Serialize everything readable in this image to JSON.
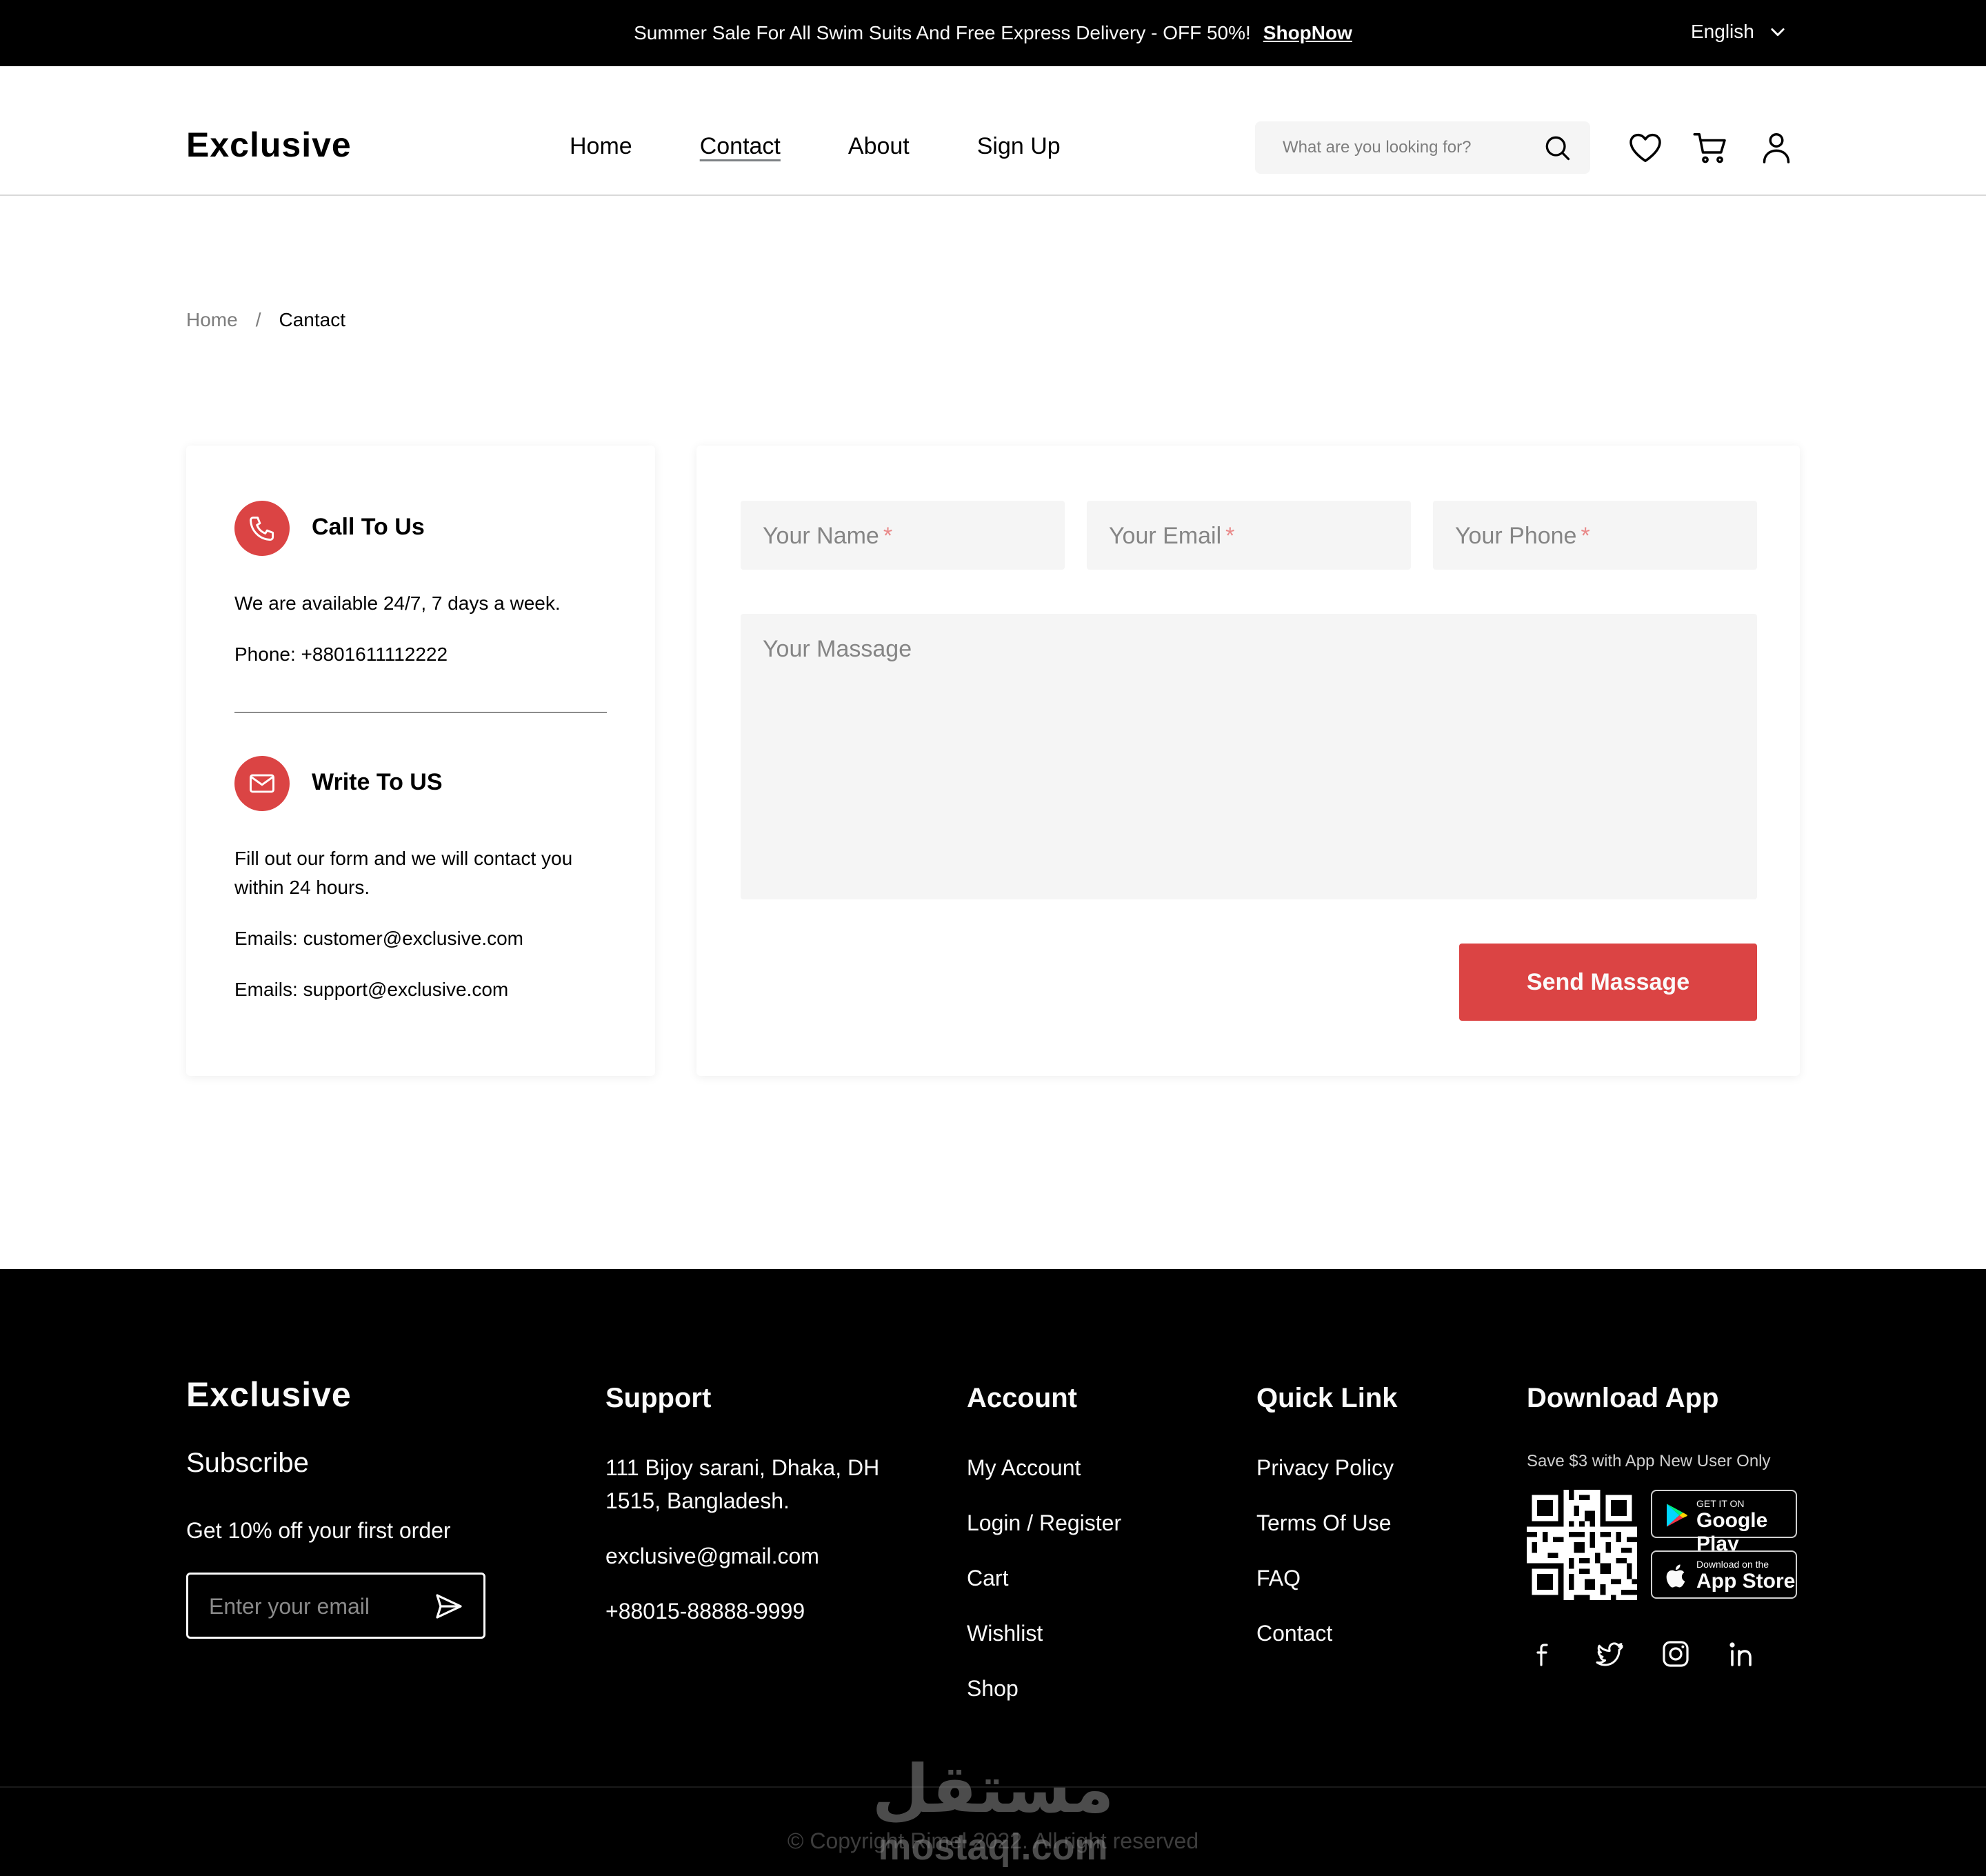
{
  "topbar": {
    "promo_text": "Summer Sale For All Swim Suits And Free Express Delivery - OFF 50%!",
    "promo_link": "ShopNow",
    "language": "English"
  },
  "header": {
    "logo": "Exclusive",
    "nav": [
      {
        "label": "Home",
        "active": false
      },
      {
        "label": "Contact",
        "active": true
      },
      {
        "label": "About",
        "active": false
      },
      {
        "label": "Sign Up",
        "active": false
      }
    ],
    "search_placeholder": "What are you looking for?",
    "icons": [
      "heart-icon",
      "cart-icon",
      "user-icon"
    ]
  },
  "breadcrumb": {
    "home": "Home",
    "separator": "/",
    "current": "Cantact"
  },
  "contact_info": {
    "call": {
      "title": "Call To Us",
      "availability": "We are available 24/7, 7 days a week.",
      "phone": "Phone: +8801611112222"
    },
    "write": {
      "title": "Write To US",
      "description": "Fill out our form and we will contact you within 24 hours.",
      "email_1": "Emails: customer@exclusive.com",
      "email_2": "Emails: support@exclusive.com"
    }
  },
  "form": {
    "name_placeholder": "Your Name",
    "email_placeholder": "Your Email",
    "phone_placeholder": "Your Phone",
    "required_mark": "*",
    "message_placeholder": "Your Massage",
    "submit_label": "Send Massage"
  },
  "footer": {
    "logo": "Exclusive",
    "subscribe_title": "Subscribe",
    "subscribe_offer": "Get 10% off your first order",
    "email_placeholder": "Enter your email",
    "support": {
      "title": "Support",
      "address": "111 Bijoy sarani, Dhaka, DH 1515, Bangladesh.",
      "email": "exclusive@gmail.com",
      "phone": "+88015-88888-9999"
    },
    "account": {
      "title": "Account",
      "links": [
        "My Account",
        "Login / Register",
        "Cart",
        "Wishlist",
        "Shop"
      ]
    },
    "quick_link": {
      "title": "Quick Link",
      "links": [
        "Privacy Policy",
        "Terms Of Use",
        "FAQ",
        "Contact"
      ]
    },
    "download": {
      "title": "Download App",
      "note": "Save $3 with App New User Only",
      "google_small": "GET IT ON",
      "google_big": "Google Play",
      "apple_small": "Download on the",
      "apple_big": "App Store"
    },
    "social": [
      "facebook-icon",
      "twitter-icon",
      "instagram-icon",
      "linkedin-icon"
    ],
    "copyright": "Copyright Rimel 2022. All right reserved",
    "watermark_arabic": "مستقل",
    "watermark_latin": "mostaql.com"
  },
  "colors": {
    "accent": "#DB4444",
    "topbar_bg": "#000000",
    "footer_bg": "#000000",
    "field_bg": "#F5F5F5"
  }
}
